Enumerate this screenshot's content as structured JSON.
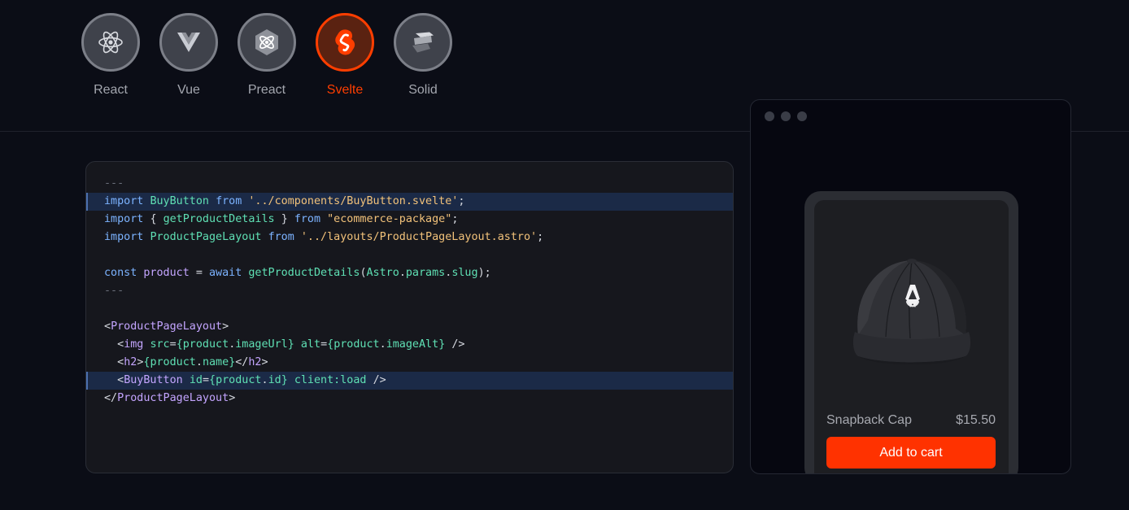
{
  "frameworks": [
    {
      "label": "React",
      "icon": "react-icon",
      "active": false
    },
    {
      "label": "Vue",
      "icon": "vue-icon",
      "active": false
    },
    {
      "label": "Preact",
      "icon": "preact-icon",
      "active": false
    },
    {
      "label": "Svelte",
      "icon": "svelte-icon",
      "active": true
    },
    {
      "label": "Solid",
      "icon": "solid-icon",
      "active": false
    }
  ],
  "colors": {
    "accent": "#ff3e00",
    "button": "#ff3200",
    "background": "#0b0d16"
  },
  "code": {
    "lines": [
      [
        [
          "cmt",
          "---"
        ]
      ],
      [
        [
          "kw",
          "import "
        ],
        [
          "fn",
          "BuyButton "
        ],
        [
          "kw",
          "from "
        ],
        [
          "str",
          "'../components/BuyButton.svelte'"
        ],
        [
          "pun",
          ";"
        ]
      ],
      [
        [
          "kw",
          "import "
        ],
        [
          "pun",
          "{ "
        ],
        [
          "fn",
          "getProductDetails "
        ],
        [
          "pun",
          "} "
        ],
        [
          "kw",
          "from "
        ],
        [
          "str",
          "\"ecommerce-package\""
        ],
        [
          "pun",
          ";"
        ]
      ],
      [
        [
          "kw",
          "import "
        ],
        [
          "fn",
          "ProductPageLayout "
        ],
        [
          "kw",
          "from "
        ],
        [
          "str",
          "'../layouts/ProductPageLayout.astro'"
        ],
        [
          "pun",
          ";"
        ]
      ],
      [],
      [
        [
          "kw",
          "const "
        ],
        [
          "tag",
          "product "
        ],
        [
          "pun",
          "= "
        ],
        [
          "kw",
          "await "
        ],
        [
          "fn",
          "getProductDetails"
        ],
        [
          "pun",
          "("
        ],
        [
          "fn",
          "Astro"
        ],
        [
          "pun",
          "."
        ],
        [
          "fn",
          "params"
        ],
        [
          "pun",
          "."
        ],
        [
          "fn",
          "slug"
        ],
        [
          "pun",
          ");"
        ]
      ],
      [
        [
          "cmt",
          "---"
        ]
      ],
      [],
      [
        [
          "pun",
          "<"
        ],
        [
          "tag",
          "ProductPageLayout"
        ],
        [
          "pun",
          ">"
        ]
      ],
      [
        [
          "pun",
          "  <"
        ],
        [
          "tag",
          "img "
        ],
        [
          "fn",
          "src"
        ],
        [
          "pun",
          "="
        ],
        [
          "brc",
          "{"
        ],
        [
          "fn",
          "product"
        ],
        [
          "pun",
          "."
        ],
        [
          "fn",
          "imageUrl"
        ],
        [
          "brc",
          "} "
        ],
        [
          "fn",
          "alt"
        ],
        [
          "pun",
          "="
        ],
        [
          "brc",
          "{"
        ],
        [
          "fn",
          "product"
        ],
        [
          "pun",
          "."
        ],
        [
          "fn",
          "imageAlt"
        ],
        [
          "brc",
          "} "
        ],
        [
          "pun",
          "/>"
        ]
      ],
      [
        [
          "pun",
          "  <"
        ],
        [
          "tag",
          "h2"
        ],
        [
          "pun",
          ">"
        ],
        [
          "brc",
          "{"
        ],
        [
          "fn",
          "product"
        ],
        [
          "pun",
          "."
        ],
        [
          "fn",
          "name"
        ],
        [
          "brc",
          "}"
        ],
        [
          "pun",
          "</"
        ],
        [
          "tag",
          "h2"
        ],
        [
          "pun",
          ">"
        ]
      ],
      [
        [
          "pun",
          "  <"
        ],
        [
          "tag",
          "BuyButton "
        ],
        [
          "fn",
          "id"
        ],
        [
          "pun",
          "="
        ],
        [
          "brc",
          "{"
        ],
        [
          "fn",
          "product"
        ],
        [
          "pun",
          "."
        ],
        [
          "fn",
          "id"
        ],
        [
          "brc",
          "} "
        ],
        [
          "fn",
          "client:load "
        ],
        [
          "pun",
          "/>"
        ]
      ],
      [
        [
          "pun",
          "</"
        ],
        [
          "tag",
          "ProductPageLayout"
        ],
        [
          "pun",
          ">"
        ]
      ]
    ],
    "highlighted": [
      1,
      11
    ]
  },
  "preview": {
    "product_name": "Snapback Cap",
    "price": "$15.50",
    "button_label": "Add to cart",
    "image_icon": "cap-icon"
  }
}
